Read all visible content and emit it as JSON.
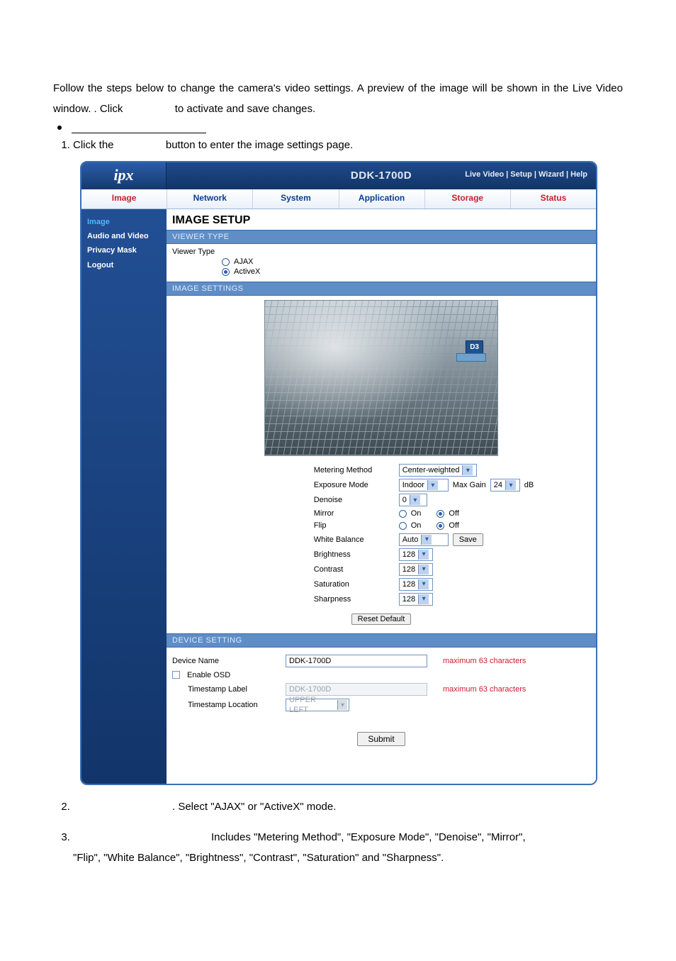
{
  "intro": {
    "line": "Follow the steps below to change the camera's video settings. A preview of the image will be shown in the Live Video window. . Click",
    "tail": "to activate and save changes."
  },
  "step1": {
    "prefix": "Click the",
    "suffix": "button to enter the image settings page."
  },
  "header": {
    "logo": "ipx",
    "model": "DDK-1700D",
    "links": "Live Video | Setup | Wizard | Help"
  },
  "tabs": [
    "Image",
    "Network",
    "System",
    "Application",
    "Storage",
    "Status"
  ],
  "sidebar": [
    "Image",
    "Audio and Video",
    "Privacy Mask",
    "Logout"
  ],
  "content": {
    "heading": "IMAGE SETUP",
    "section_viewer": "VIEWER TYPE",
    "viewer_label": "Viewer Type",
    "viewer_options": {
      "ajax": "AJAX",
      "activex": "ActiveX"
    },
    "section_image": "IMAGE SETTINGS",
    "preview_badge": "D3",
    "settings": {
      "metering_label": "Metering Method",
      "metering_value": "Center-weighted",
      "exposure_label": "Exposure Mode",
      "exposure_value": "Indoor",
      "max_gain_label": "Max Gain",
      "max_gain_value": "24",
      "max_gain_unit": "dB",
      "denoise_label": "Denoise",
      "denoise_value": "0",
      "mirror_label": "Mirror",
      "flip_label": "Flip",
      "on": "On",
      "off": "Off",
      "wb_label": "White Balance",
      "wb_value": "Auto",
      "save_btn": "Save",
      "brightness_label": "Brightness",
      "brightness_value": "128",
      "contrast_label": "Contrast",
      "contrast_value": "128",
      "saturation_label": "Saturation",
      "saturation_value": "128",
      "sharpness_label": "Sharpness",
      "sharpness_value": "128",
      "reset_btn": "Reset Default"
    },
    "section_device": "DEVICE SETTING",
    "device": {
      "name_label": "Device Name",
      "name_value": "DDK-1700D",
      "max_note": "maximum 63 characters",
      "osd_label": "Enable OSD",
      "ts_label_label": "Timestamp Label",
      "ts_label_value": "DDK-1700D",
      "ts_loc_label": "Timestamp Location",
      "ts_loc_value": "UPPER LEFT"
    },
    "submit": "Submit"
  },
  "after": {
    "step2": ". Select \"AJAX\" or \"ActiveX\" mode.",
    "step3a": "Includes \"Metering Method\", \"Exposure Mode\", \"Denoise\", \"Mirror\",",
    "step3b": "\"Flip\", \"White Balance\", \"Brightness\", \"Contrast\", \"Saturation\" and \"Sharpness\"."
  }
}
